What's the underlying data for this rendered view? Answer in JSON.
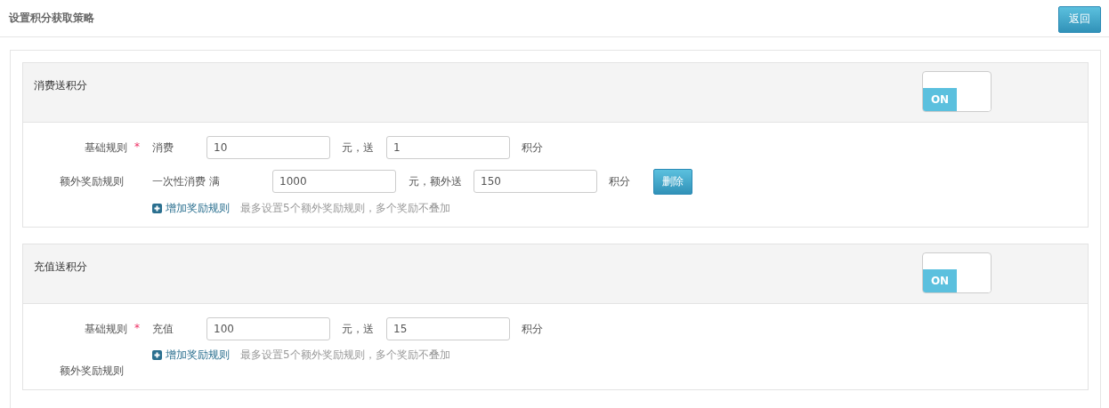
{
  "page_title": "设置积分获取策略",
  "back_button": "返回",
  "sections": [
    {
      "title": "消费送积分",
      "toggle": {
        "on": true,
        "label": "ON"
      },
      "base_rule": {
        "label": "基础规则",
        "required_mark": "*",
        "prefix": "消费",
        "amount": "10",
        "mid_text": "元，送",
        "points": "1",
        "suffix": "积分"
      },
      "extra_label": "额外奖励规则",
      "extra_rules": [
        {
          "prefix": "一次性消费 满",
          "amount": "1000",
          "mid_text": "元，额外送",
          "points": "150",
          "suffix": "积分",
          "delete_button": "删除"
        }
      ],
      "add_link": "增加奖励规则",
      "hint": "最多设置5个额外奖励规则，多个奖励不叠加"
    },
    {
      "title": "充值送积分",
      "toggle": {
        "on": true,
        "label": "ON"
      },
      "base_rule": {
        "label": "基础规则",
        "required_mark": "*",
        "prefix": "充值",
        "amount": "100",
        "mid_text": "元，送",
        "points": "15",
        "suffix": "积分"
      },
      "extra_label": "额外奖励规则",
      "add_link": "增加奖励规则",
      "hint": "最多设置5个额外奖励规则，多个奖励不叠加"
    }
  ]
}
